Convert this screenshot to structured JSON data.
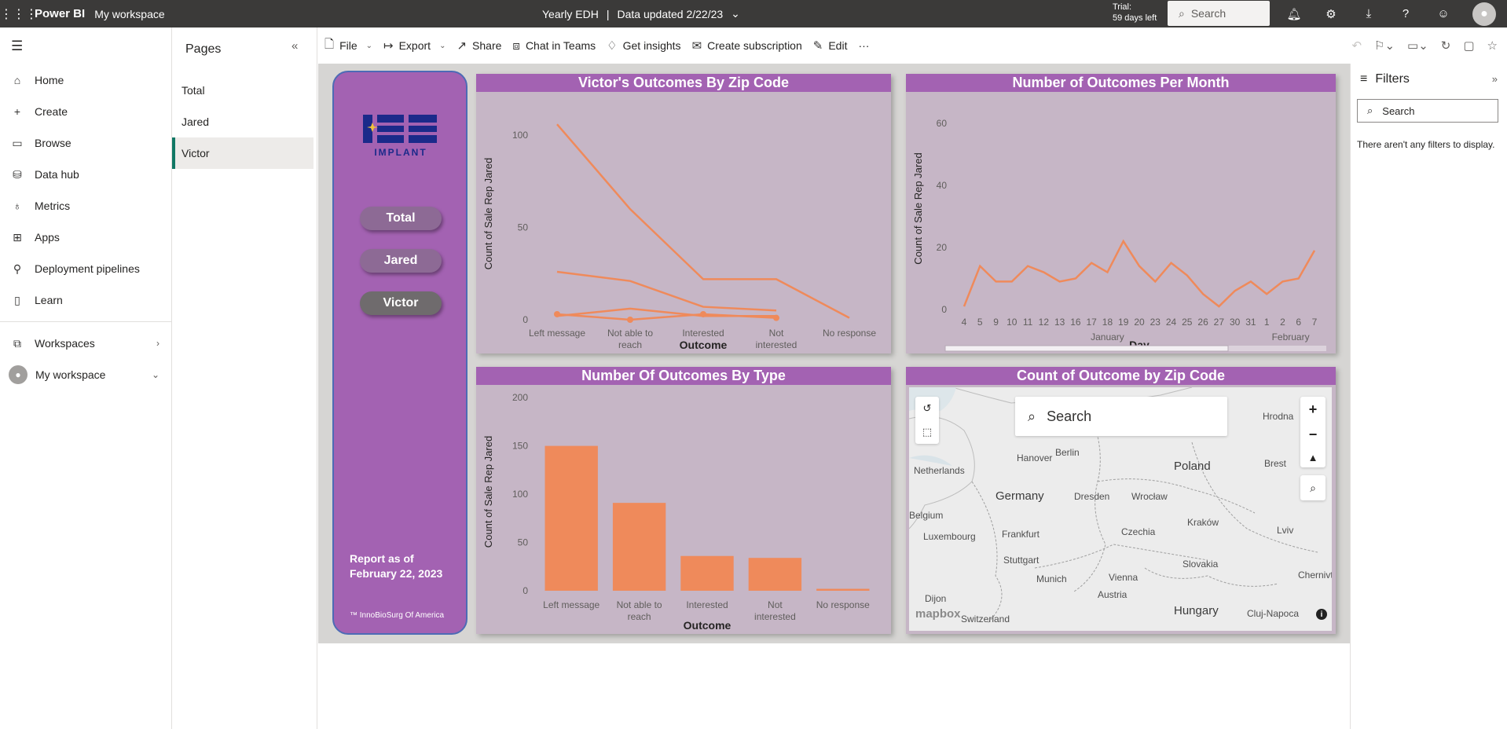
{
  "topbar": {
    "app_name": "Power BI",
    "workspace": "My workspace",
    "report_name": "Yearly EDH",
    "separator": "|",
    "data_updated": "Data updated 2/22/23",
    "trial_line1": "Trial:",
    "trial_line2": "59 days left",
    "search_placeholder": "Search"
  },
  "leftnav": {
    "items": [
      {
        "label": "Home"
      },
      {
        "label": "Create"
      },
      {
        "label": "Browse"
      },
      {
        "label": "Data hub"
      },
      {
        "label": "Metrics"
      },
      {
        "label": "Apps"
      },
      {
        "label": "Deployment pipelines"
      },
      {
        "label": "Learn"
      }
    ],
    "workspaces": "Workspaces",
    "my_workspace": "My workspace"
  },
  "pages": {
    "title": "Pages",
    "items": [
      "Total",
      "Jared",
      "Victor"
    ],
    "active": "Victor"
  },
  "cmdbar": {
    "file": "File",
    "export": "Export",
    "share": "Share",
    "chat": "Chat in Teams",
    "insights": "Get insights",
    "subscription": "Create subscription",
    "edit": "Edit",
    "more": "···"
  },
  "report": {
    "logo_text": "IMPLANT",
    "buttons": [
      "Total",
      "Jared",
      "Victor"
    ],
    "report_as_line1": "Report as of",
    "report_as_line2": "February 22, 2023",
    "trademark": "™ InnoBioSurg Of America"
  },
  "map": {
    "title": "Count of Outcome by Zip Code",
    "search_placeholder": "Search",
    "attribution": "mapbox",
    "labels": [
      {
        "text": "Netherlands"
      },
      {
        "text": "Hanover"
      },
      {
        "text": "Berlin"
      },
      {
        "text": "Poland"
      },
      {
        "text": "Germany"
      },
      {
        "text": "Dresden"
      },
      {
        "text": "Wrocław"
      },
      {
        "text": "Brest"
      },
      {
        "text": "Belgium"
      },
      {
        "text": "Frankfurt"
      },
      {
        "text": "Czechia"
      },
      {
        "text": "Kraków"
      },
      {
        "text": "Luxembourg"
      },
      {
        "text": "Lviv"
      },
      {
        "text": "Stuttgart"
      },
      {
        "text": "Slovakia"
      },
      {
        "text": "Munich"
      },
      {
        "text": "Vienna"
      },
      {
        "text": "Dijon"
      },
      {
        "text": "Austria"
      },
      {
        "text": "Switzerland"
      },
      {
        "text": "Hungary"
      },
      {
        "text": "Cluj-Napoca"
      },
      {
        "text": "Chernivt"
      },
      {
        "text": "Hrodna"
      }
    ]
  },
  "filters": {
    "title": "Filters",
    "search_placeholder": "Search",
    "empty": "There aren't any filters to display."
  },
  "chart_data": [
    {
      "type": "line",
      "title": "Victor's Outcomes By Zip Code",
      "xlabel": "Outcome",
      "ylabel": "Count of Sale Rep Jared",
      "categories": [
        "Left message",
        "Not able to reach",
        "Interested",
        "Not interested",
        "No response"
      ],
      "yticks": [
        0,
        50,
        100
      ],
      "ylim": [
        0,
        115
      ],
      "series": [
        {
          "values": [
            106,
            60,
            22,
            22,
            1
          ]
        },
        {
          "values": [
            26,
            21,
            7,
            5,
            null
          ]
        },
        {
          "values": [
            2,
            6,
            2,
            2,
            null
          ]
        },
        {
          "values": [
            3,
            0,
            3,
            1,
            null
          ]
        }
      ]
    },
    {
      "type": "line",
      "title": "Number of Outcomes Per Month",
      "xlabel": "Day",
      "ylabel": "Count of Sale Rep Jared",
      "categories": [
        "4",
        "5",
        "9",
        "10",
        "11",
        "12",
        "13",
        "16",
        "17",
        "18",
        "19",
        "20",
        "23",
        "24",
        "25",
        "26",
        "27",
        "30",
        "31",
        "1",
        "2",
        "6",
        "7"
      ],
      "month_labels": [
        {
          "text": "January",
          "index": 9
        },
        {
          "text": "February",
          "index": 20.5
        }
      ],
      "yticks": [
        0,
        20,
        40,
        60
      ],
      "ylim": [
        0,
        65
      ],
      "series": [
        {
          "values": [
            1,
            14,
            9,
            9,
            14,
            12,
            9,
            10,
            15,
            12,
            22,
            14,
            9,
            15,
            11,
            5,
            1,
            6,
            9,
            5,
            9,
            10,
            19
          ]
        }
      ]
    },
    {
      "type": "bar",
      "title": "Number Of Outcomes By Type",
      "xlabel": "Outcome",
      "ylabel": "Count of Sale Rep Jared",
      "categories": [
        "Left message",
        "Not able to reach",
        "Interested",
        "Not interested",
        "No response"
      ],
      "values": [
        150,
        91,
        36,
        34,
        2
      ],
      "yticks": [
        0,
        50,
        100,
        150,
        200
      ],
      "ylim": [
        0,
        205
      ]
    }
  ],
  "colors": {
    "accent": "#a362b2",
    "visual_bg": "#c6b6c6",
    "series": "#ef8a5b"
  }
}
